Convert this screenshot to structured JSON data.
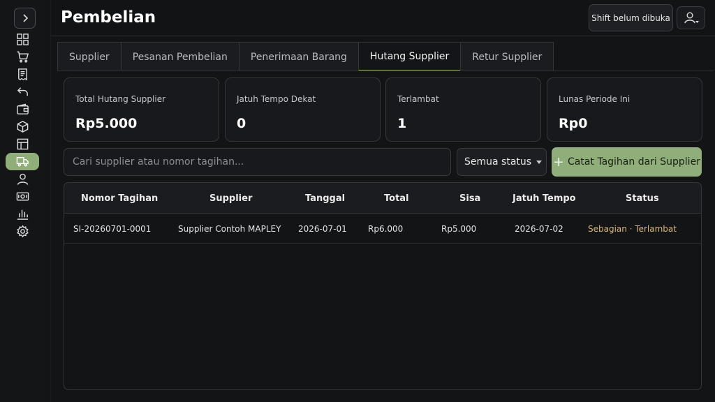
{
  "sidebar": {
    "toggle_icon": "chevron-right-icon",
    "items": [
      {
        "icon": "grid-icon",
        "active": false
      },
      {
        "icon": "cart-icon",
        "active": false
      },
      {
        "icon": "receipt-icon",
        "active": false
      },
      {
        "icon": "undo-icon",
        "active": false
      },
      {
        "icon": "wallet-icon",
        "active": false
      },
      {
        "icon": "box-icon",
        "active": false
      },
      {
        "icon": "table-icon",
        "active": false
      },
      {
        "icon": "truck-icon",
        "active": true
      },
      {
        "icon": "user-icon",
        "active": false
      },
      {
        "icon": "cash-icon",
        "active": false
      },
      {
        "icon": "bar-chart-icon",
        "active": false
      },
      {
        "icon": "gear-icon",
        "active": false
      }
    ],
    "accent": "#8fae7a"
  },
  "header": {
    "title": "Pembelian",
    "shift_label": "Shift belum dibuka",
    "user_icon": "user-dropdown-icon"
  },
  "tabs": [
    {
      "label": "Supplier",
      "active": false
    },
    {
      "label": "Pesanan Pembelian",
      "active": false
    },
    {
      "label": "Penerimaan Barang",
      "active": false
    },
    {
      "label": "Hutang Supplier",
      "active": true
    },
    {
      "label": "Retur Supplier",
      "active": false
    }
  ],
  "cards": [
    {
      "label": "Total Hutang Supplier",
      "value": "Rp5.000"
    },
    {
      "label": "Jatuh Tempo Dekat",
      "value": "0"
    },
    {
      "label": "Terlambat",
      "value": "1"
    },
    {
      "label": "Lunas Periode Ini",
      "value": "Rp0"
    }
  ],
  "search": {
    "placeholder": "Cari supplier atau nomor tagihan..."
  },
  "status_filter": {
    "selected": "Semua status"
  },
  "add_button": {
    "label": "Catat Tagihan dari Supplier"
  },
  "table": {
    "headers": [
      "Nomor Tagihan",
      "Supplier",
      "Tanggal",
      "Total",
      "Sisa",
      "Jatuh Tempo",
      "Status"
    ],
    "rows": [
      {
        "nomor": "SI-20260701-0001",
        "supplier": "Supplier Contoh MAPLEY",
        "tanggal": "2026-07-01",
        "total": "Rp6.000",
        "sisa": "Rp5.000",
        "jatuh_tempo": "2026-07-02",
        "status": "Sebagian · Terlambat"
      }
    ],
    "status_color": "#d9b57a"
  }
}
